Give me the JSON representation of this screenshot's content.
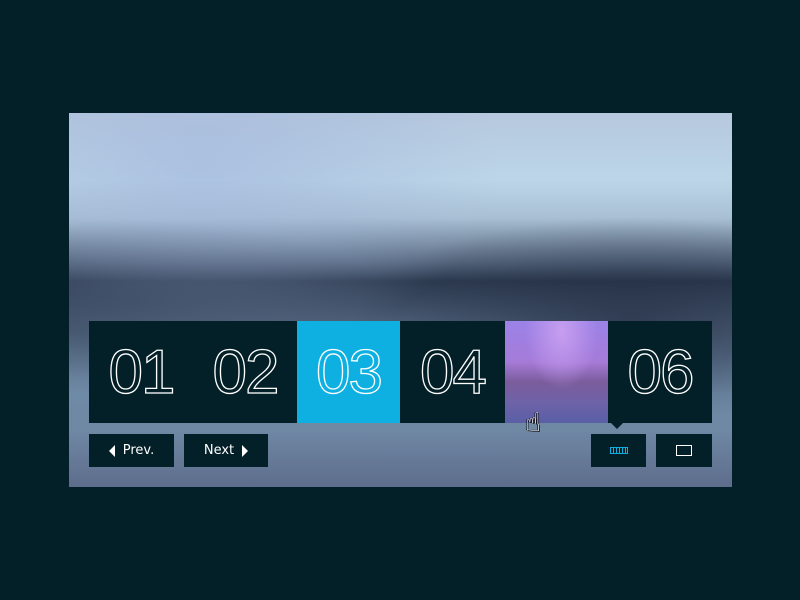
{
  "slider": {
    "tiles": [
      {
        "label": "01",
        "state": "default"
      },
      {
        "label": "02",
        "state": "default"
      },
      {
        "label": "03",
        "state": "active"
      },
      {
        "label": "04",
        "state": "default"
      },
      {
        "label": "",
        "state": "image-preview"
      },
      {
        "label": "06",
        "state": "default"
      }
    ],
    "active_color": "#0eb0e2",
    "tile_color": "#031f27"
  },
  "controls": {
    "prev_label": "Prev.",
    "next_label": "Next",
    "view_modes": [
      "grid-view",
      "single-view"
    ],
    "selected_view": "grid-view"
  },
  "cursor": "hand-pointer"
}
